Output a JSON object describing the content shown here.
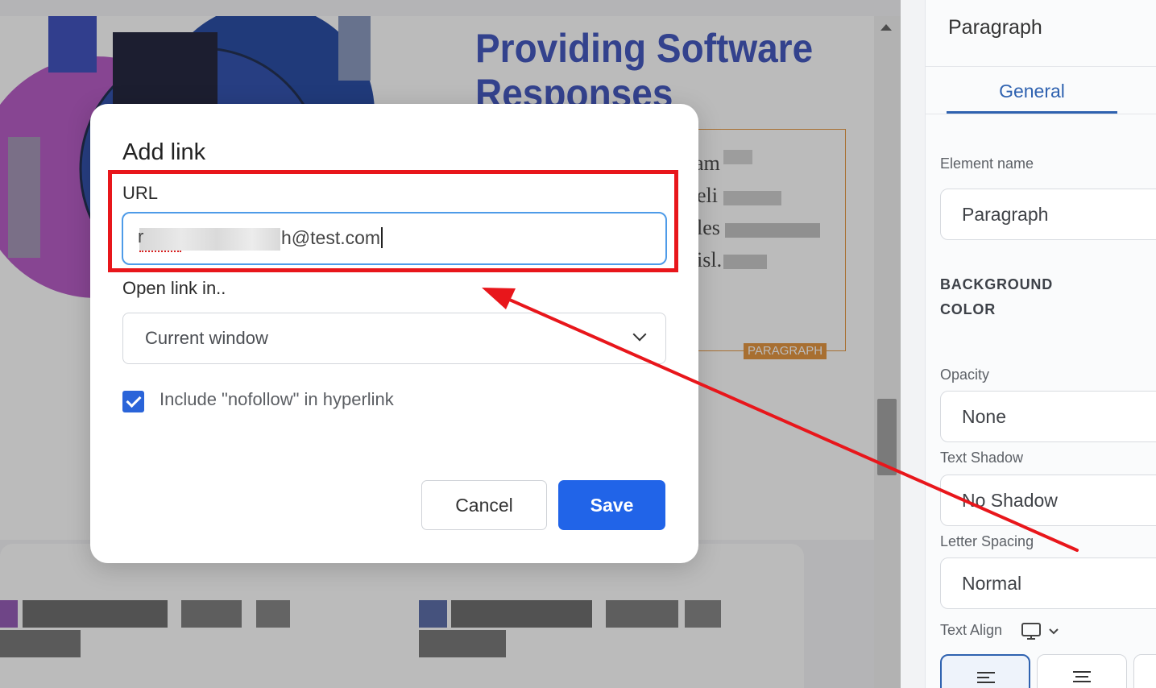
{
  "canvas": {
    "heading": "Providing Software Responses",
    "paragraph_tag": "PARAGRAPH",
    "paragraph_fragments": [
      "am",
      "eli",
      "les",
      "isl."
    ]
  },
  "panel": {
    "title": "Paragraph",
    "tab_general": "General",
    "element_name_label": "Element name",
    "element_name_value": "Paragraph",
    "background_color_label": "BACKGROUND COLOR",
    "opacity_label": "Opacity",
    "opacity_value": "None",
    "text_shadow_label": "Text Shadow",
    "text_shadow_value": "No Shadow",
    "letter_spacing_label": "Letter Spacing",
    "letter_spacing_value": "Normal",
    "text_align_label": "Text Align",
    "text_align_icons": [
      "align-left-icon",
      "align-center-icon"
    ]
  },
  "modal": {
    "title": "Add link",
    "url_label": "URL",
    "url_prefix": "r",
    "url_visible_suffix": "h@test.com",
    "open_label": "Open link in..",
    "open_value": "Current window",
    "nofollow_label": "Include \"nofollow\" in hyperlink",
    "nofollow_checked": true,
    "cancel_label": "Cancel",
    "save_label": "Save"
  },
  "colors": {
    "accent_blue": "#2164e8",
    "heading_blue": "#2f46b8",
    "annotation_red": "#e8161b",
    "paragraph_orange": "#e28a2b"
  }
}
